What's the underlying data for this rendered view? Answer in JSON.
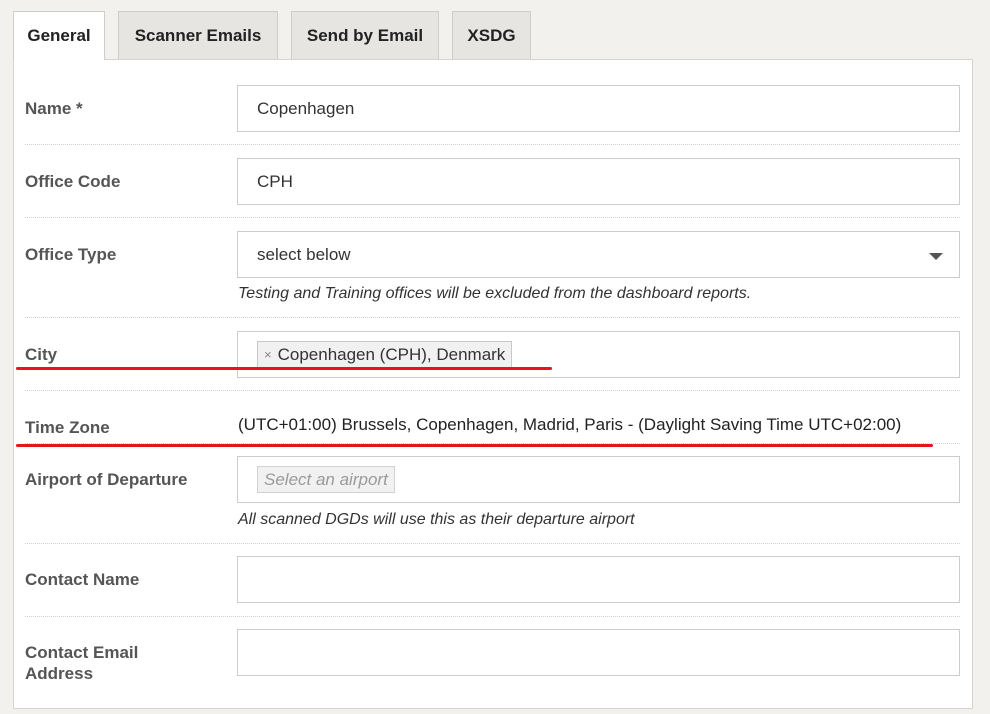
{
  "tabs": [
    {
      "label": "General",
      "active": true
    },
    {
      "label": "Scanner Emails",
      "active": false
    },
    {
      "label": "Send by Email",
      "active": false
    },
    {
      "label": "XSDG",
      "active": false
    }
  ],
  "form": {
    "name": {
      "label": "Name *",
      "value": "Copenhagen"
    },
    "office_code": {
      "label": "Office Code",
      "value": "CPH"
    },
    "office_type": {
      "label": "Office Type",
      "value": "select below",
      "hint": "Testing and Training offices will be excluded from the dashboard reports."
    },
    "city": {
      "label": "City",
      "remove_symbol": "×",
      "value": "Copenhagen (CPH), Denmark"
    },
    "time_zone": {
      "label": "Time Zone",
      "value": "(UTC+01:00) Brussels, Copenhagen, Madrid, Paris - (Daylight Saving Time UTC+02:00)"
    },
    "airport": {
      "label": "Airport of Departure",
      "placeholder": "Select an airport",
      "hint": "All scanned DGDs will use this as their departure airport"
    },
    "contact_name": {
      "label": "Contact Name",
      "value": ""
    },
    "contact_email": {
      "label": "Contact Email Address",
      "value": ""
    }
  },
  "colors": {
    "annotation_underline": "#e8141c"
  }
}
